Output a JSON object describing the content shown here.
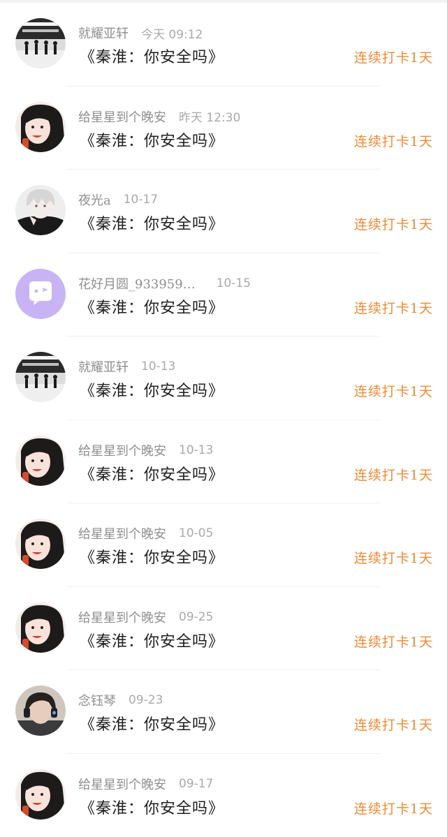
{
  "colors": {
    "username": "#8f8f8f",
    "time": "#a9a9a9",
    "title": "#1e1e1e",
    "streak": "#ec8a35",
    "avatar_purple": "#c8b4f4"
  },
  "entries": [
    {
      "username": "就耀亚轩",
      "time": "今天 09:12",
      "title": "《秦淮：你安全吗》",
      "streak": "连续打卡1天",
      "avatar": "dance-group-avatar"
    },
    {
      "username": "给星星到个晚安",
      "time": "昨天 12:30",
      "title": "《秦淮：你安全吗》",
      "streak": "连续打卡1天",
      "avatar": "girl-portrait-avatar"
    },
    {
      "username": "夜光a",
      "time": "10-17",
      "title": "《秦淮：你安全吗》",
      "streak": "连续打卡1天",
      "avatar": "white-hair-boy-avatar"
    },
    {
      "username": "花好月圆_933959…",
      "time": "10-15",
      "title": "《秦淮：你安全吗》",
      "streak": "连续打卡1天",
      "avatar": "chat-bubble-avatar"
    },
    {
      "username": "就耀亚轩",
      "time": "10-13",
      "title": "《秦淮：你安全吗》",
      "streak": "连续打卡1天",
      "avatar": "dance-group-avatar"
    },
    {
      "username": "给星星到个晚安",
      "time": "10-13",
      "title": "《秦淮：你安全吗》",
      "streak": "连续打卡1天",
      "avatar": "girl-portrait-avatar"
    },
    {
      "username": "给星星到个晚安",
      "time": "10-05",
      "title": "《秦淮：你安全吗》",
      "streak": "连续打卡1天",
      "avatar": "girl-portrait-avatar"
    },
    {
      "username": "给星星到个晚安",
      "time": "09-25",
      "title": "《秦淮：你安全吗》",
      "streak": "连续打卡1天",
      "avatar": "girl-portrait-avatar"
    },
    {
      "username": "念钰琴",
      "time": "09-23",
      "title": "《秦淮：你安全吗》",
      "streak": "连续打卡1天",
      "avatar": "headphones-boy-avatar"
    },
    {
      "username": "给星星到个晚安",
      "time": "09-17",
      "title": "《秦淮：你安全吗》",
      "streak": "连续打卡1天",
      "avatar": "girl-portrait-avatar"
    }
  ]
}
